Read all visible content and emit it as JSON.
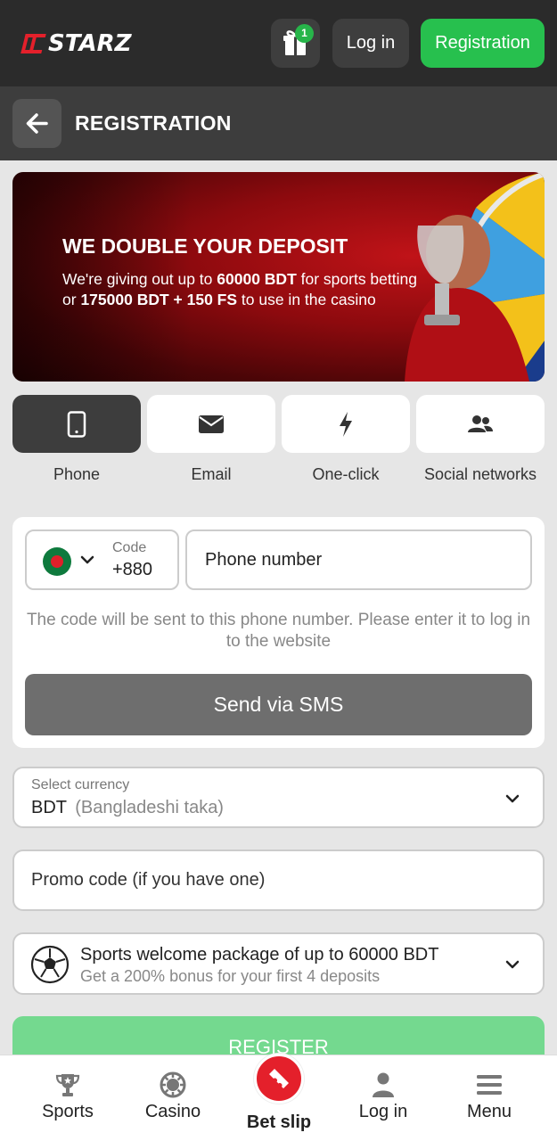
{
  "header": {
    "logo": "STARZ",
    "gift_badge": "1",
    "login_label": "Log in",
    "registration_label": "Registration"
  },
  "titlebar": {
    "title": "REGISTRATION"
  },
  "banner": {
    "title": "WE DOUBLE YOUR DEPOSIT",
    "line1_pre": "We're giving out up to ",
    "line1_bold": "60000 BDT",
    "line1_post": " for sports betting",
    "line2_pre": "or ",
    "line2_bold": "175000 BDT + 150 FS",
    "line2_post": " to use in the casino"
  },
  "tabs": [
    {
      "label": "Phone",
      "icon": "phone-icon",
      "active": true
    },
    {
      "label": "Email",
      "icon": "envelope-icon",
      "active": false
    },
    {
      "label": "One-click",
      "icon": "lightning-icon",
      "active": false
    },
    {
      "label": "Social networks",
      "icon": "users-icon",
      "active": false
    }
  ],
  "phone_form": {
    "code_label": "Code",
    "code_value": "+880",
    "phone_placeholder": "Phone number",
    "hint": "The code will be sent to this phone number. Please enter it to log in to the website",
    "send_label": "Send via SMS"
  },
  "currency": {
    "label": "Select currency",
    "code": "BDT",
    "name": "(Bangladeshi taka)"
  },
  "promo": {
    "placeholder": "Promo code (if you have one)"
  },
  "bonus": {
    "title": "Sports welcome package of up to 60000 BDT",
    "subtitle": "Get a 200% bonus for your first 4 deposits"
  },
  "register_label": "REGISTER",
  "bottom_nav": {
    "items": [
      {
        "label": "Sports",
        "icon": "trophy-icon"
      },
      {
        "label": "Casino",
        "icon": "casino-chip-icon"
      },
      {
        "label": "Bet slip",
        "icon": "ticket-icon"
      },
      {
        "label": "Log in",
        "icon": "user-icon"
      },
      {
        "label": "Menu",
        "icon": "menu-icon"
      }
    ]
  },
  "colors": {
    "header_bg": "#2b2b2b",
    "accent_green": "#27c04e",
    "brand_red": "#e4202b",
    "active_tab": "#3d3d3d",
    "sms_button": "#6e6e6e",
    "register_button": "#74d98f"
  }
}
